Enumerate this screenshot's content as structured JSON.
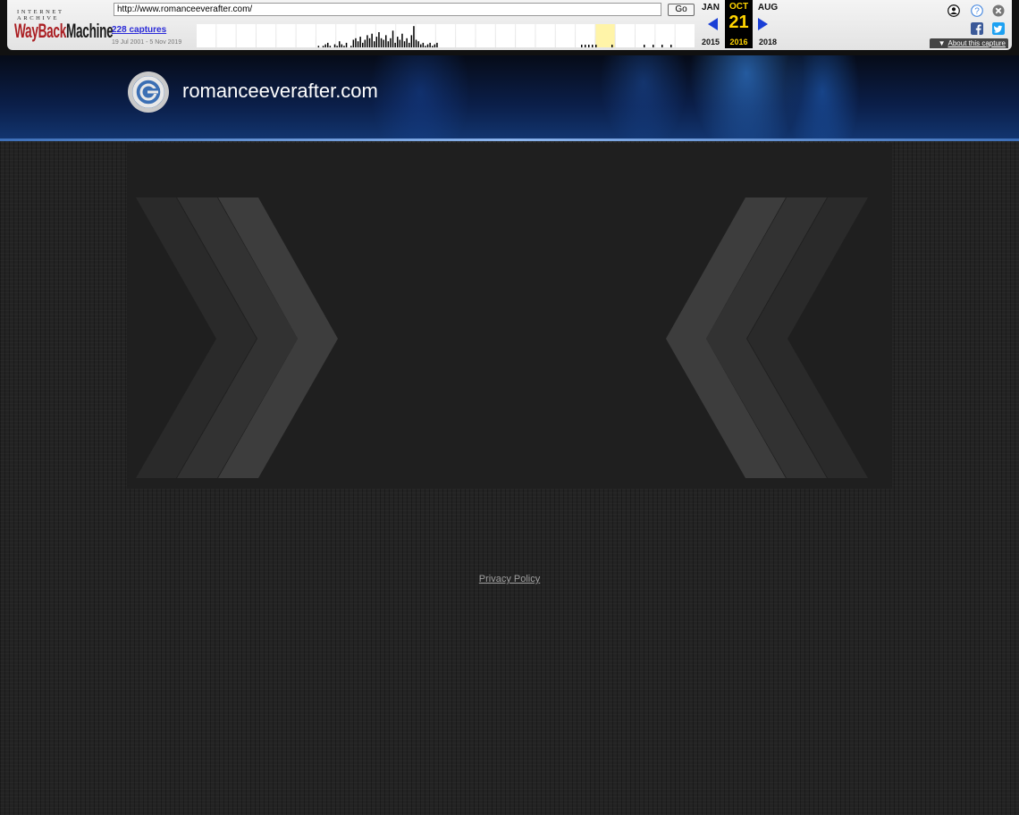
{
  "wayback": {
    "brand_top": "INTERNET ARCHIVE",
    "brand_wayback": "WayBack",
    "brand_machine": "Machine",
    "url_value": "http://www.romanceeverafter.com/",
    "go_label": "Go",
    "captures_label": "228 captures",
    "date_range": "19 Jul 2001 - 5 Nov 2019",
    "prev_month": "JAN",
    "current_month": "OCT",
    "next_month": "AUG",
    "current_day": "21",
    "prev_year": "2015",
    "current_year": "2016",
    "next_year": "2018",
    "about_label": "About this capture",
    "highlight_color": "#ffd400",
    "arrow_color": "#1a3fd6"
  },
  "site": {
    "title": "romanceeverafter.com",
    "privacy_label": "Privacy Policy",
    "accent_color": "#3d6fb8"
  }
}
